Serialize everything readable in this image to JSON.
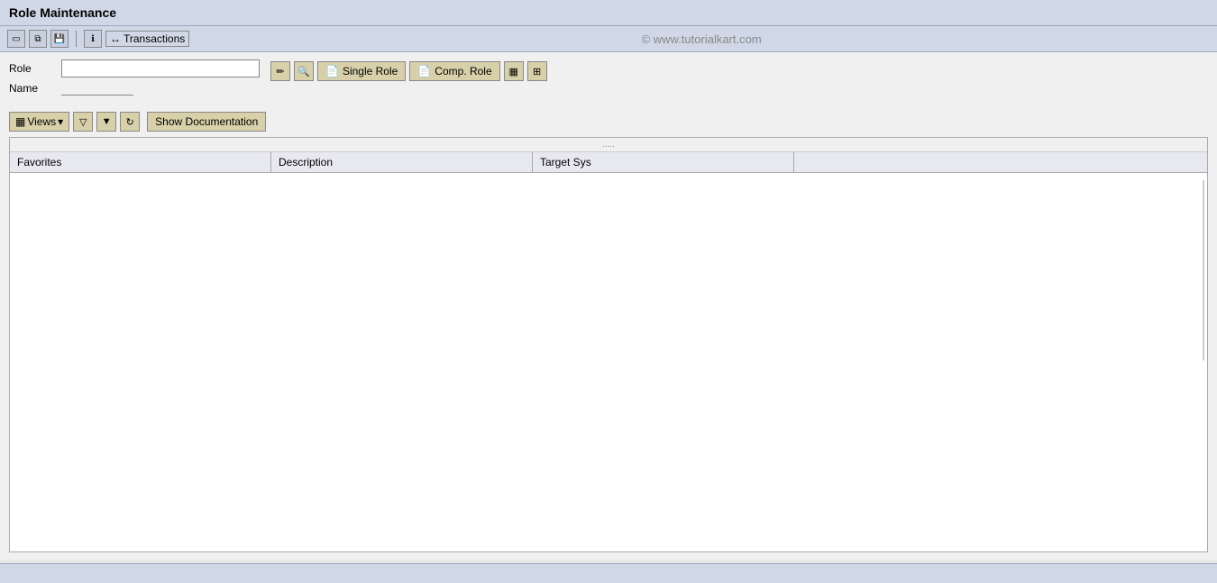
{
  "title": "Role Maintenance",
  "toolbar": {
    "transactions_label": "Transactions",
    "watermark": "© www.tutorialkart.com"
  },
  "fields": {
    "role_label": "Role",
    "name_label": "Name",
    "role_value": "",
    "name_value": ""
  },
  "role_buttons": {
    "edit_icon": "✏",
    "search_icon": "🔍",
    "single_role_label": "Single Role",
    "comp_role_label": "Comp. Role",
    "icon1": "▦",
    "icon2": "⊞"
  },
  "second_toolbar": {
    "views_label": "Views",
    "filter_icon1": "▽",
    "filter_icon2": "▼",
    "refresh_icon": "↻",
    "show_documentation_label": "Show Documentation"
  },
  "table": {
    "dots": ".....",
    "columns": [
      {
        "id": "favorites",
        "label": "Favorites"
      },
      {
        "id": "description",
        "label": "Description"
      },
      {
        "id": "target_sys",
        "label": "Target Sys"
      },
      {
        "id": "extra",
        "label": ""
      }
    ]
  }
}
